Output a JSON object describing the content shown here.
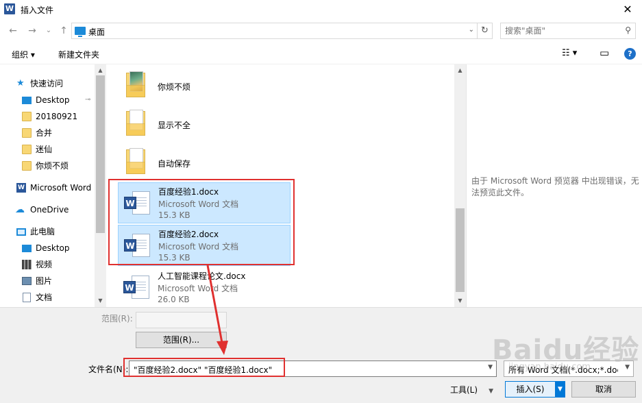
{
  "window": {
    "title": "插入文件",
    "app_icon": "W",
    "close_glyph": "✕"
  },
  "nav": {
    "back": "←",
    "forward": "→",
    "recent": "⌄",
    "up": "↑",
    "address": "桌面",
    "address_drop": "⌄",
    "refresh": "↻",
    "search_placeholder": "搜索\"桌面\"",
    "search_glyph": "⚲"
  },
  "toolbar": {
    "organize": "组织 ▾",
    "new_folder": "新建文件夹",
    "view_glyph": "☷ ▾",
    "pane_glyph": "▭",
    "help": "?"
  },
  "sidebar": {
    "items": [
      {
        "label": "快速访问",
        "icon": "star-icon"
      },
      {
        "label": "Desktop",
        "icon": "desktop-icon",
        "pinned": true
      },
      {
        "label": "20180921",
        "icon": "folder-icon"
      },
      {
        "label": "合并",
        "icon": "folder-icon"
      },
      {
        "label": "迷仙",
        "icon": "folder-icon"
      },
      {
        "label": "你烦不烦",
        "icon": "folder-icon"
      },
      {
        "label": "Microsoft Word",
        "icon": "word-icon"
      },
      {
        "label": "OneDrive",
        "icon": "cloud-icon"
      },
      {
        "label": "此电脑",
        "icon": "computer-icon"
      },
      {
        "label": "Desktop",
        "icon": "desktop-icon"
      },
      {
        "label": "视频",
        "icon": "video-icon"
      },
      {
        "label": "图片",
        "icon": "pictures-icon"
      },
      {
        "label": "文档",
        "icon": "documents-icon"
      }
    ],
    "pin_glyph": "📌"
  },
  "files": [
    {
      "name": "你烦不烦",
      "kind": "folder",
      "thumb": "img"
    },
    {
      "name": "显示不全",
      "kind": "folder",
      "thumb": "doc"
    },
    {
      "name": "自动保存",
      "kind": "folder",
      "thumb": "doc"
    },
    {
      "name": "百度经验1.docx",
      "kind": "doc",
      "type": "Microsoft Word 文档",
      "size": "15.3 KB",
      "selected": true
    },
    {
      "name": "百度经验2.docx",
      "kind": "doc",
      "type": "Microsoft Word 文档",
      "size": "15.3 KB",
      "selected": true
    },
    {
      "name": "人工智能课程论文.docx",
      "kind": "doc",
      "type": "Microsoft Word 文档",
      "size": "26.0 KB",
      "selected": false
    }
  ],
  "preview": {
    "message": "由于 Microsoft Word 预览器 中出现错误，无法预览此文件。"
  },
  "bottom": {
    "range_label": "范围(R):",
    "range_button": "范围(R)...",
    "filename_label": "文件名(N):",
    "filename_value": "\"百度经验2.docx\" \"百度经验1.docx\"",
    "filetype_value": "所有 Word 文档(*.docx;*.docm",
    "tools": "工具(L)",
    "insert": "插入(S)",
    "cancel": "取消"
  },
  "watermark": {
    "brand": "Baidu经验",
    "sub": "jingyan.baidu.com"
  },
  "colors": {
    "selection": "#cce8ff",
    "annotation": "#e0302f",
    "accent": "#0078d7"
  }
}
